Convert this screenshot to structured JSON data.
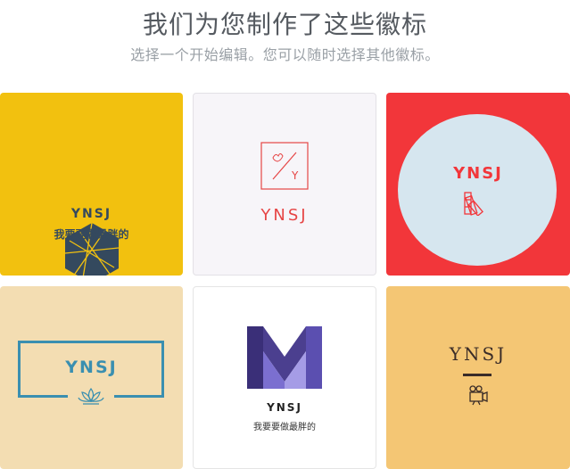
{
  "header": {
    "title": "我们为您制作了这些徽标",
    "subtitle": "选择一个开始编辑。您可以随时选择其他徽标。"
  },
  "logos": [
    {
      "name": "YNSJ",
      "slogan": "我要要做最胖的",
      "background": "#f2c10f",
      "icon": "hexagon-icon"
    },
    {
      "name": "YNSJ",
      "monogram": "Y",
      "background": "#f7f5f9",
      "icon": "flame-monogram-icon"
    },
    {
      "name": "YNSJ",
      "background": "#f2363a",
      "icon": "color-swatch-fan-icon"
    },
    {
      "name": "YNSJ",
      "background": "#f3ddb2",
      "icon": "lotus-icon"
    },
    {
      "name": "YNSJ",
      "slogan": "我要要做最胖的",
      "background": "#ffffff",
      "icon": "letter-m-icon"
    },
    {
      "name": "YNSJ",
      "background": "#f4c674",
      "icon": "film-camera-icon"
    }
  ]
}
